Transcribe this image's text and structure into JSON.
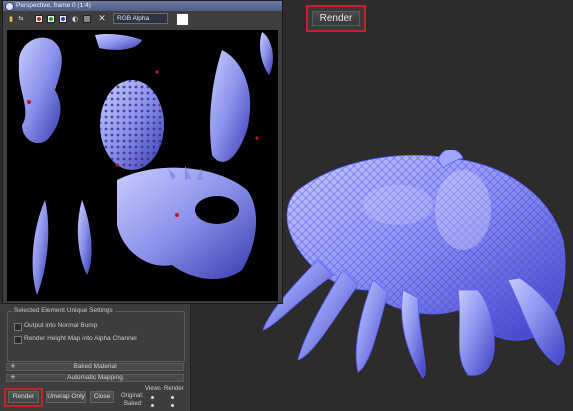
{
  "render_window": {
    "title": "Perspective, frame 0 (1:4)",
    "channel": "RGB Alpha",
    "toolbar_icons": [
      "save-image-icon",
      "clone-window-icon",
      "red-channel-icon",
      "green-channel-icon",
      "blue-channel-icon",
      "monochrome-icon",
      "clear-icon"
    ]
  },
  "viewport": {
    "render_button": "Render"
  },
  "panel": {
    "group_title": "Selected Element Unique Settings",
    "option_normal_bump": "Output into Normal Bump",
    "option_height_map": "Render Height Map into Alpha Channel",
    "rollout_baked": "Baked Material",
    "rollout_mapping": "Automatic Mapping",
    "render_label": "Render",
    "unwrap_label": "Unwrap Only",
    "close_label": "Close",
    "views_label": "Views",
    "render_col_label": "Render",
    "original_label": "Original:",
    "baked_label": "Baked:",
    "plus": "+"
  },
  "colors": {
    "accent_red": "#c8202a",
    "normal_map_blue": "#8f9bff",
    "wire": "#5b5cff"
  }
}
